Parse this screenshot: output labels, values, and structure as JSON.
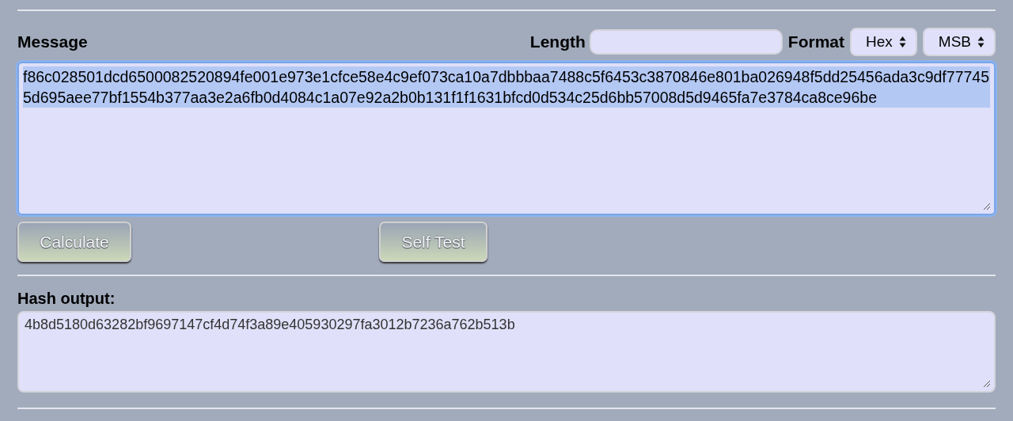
{
  "message": {
    "label": "Message",
    "value": "f86c028501dcd6500082520894fe001e973e1cfce58e4c9ef073ca10a7dbbbaa7488c5f6453c3870846e801ba026948f5dd25456ada3c9df777455d695aee77bf1554b377aa3e2a6fb0d4084c1a07e92a2b0b131f1f1631bfcd0d534c25d6bb57008d5d9465fa7e3784ca8ce96be",
    "text_selected": true,
    "focused": true
  },
  "length": {
    "label": "Length"
  },
  "format": {
    "label": "Format",
    "selects": [
      "Hex",
      "MSB"
    ]
  },
  "buttons": [
    {
      "label": "Calculate",
      "disabled": true
    },
    {
      "label": "Self Test",
      "disabled": true
    }
  ],
  "output": {
    "label": "Hash output:",
    "value": "4b8d5180d63282bf9697147cf4d74f3a89e405930297fa3012b7236a762b513b"
  }
}
